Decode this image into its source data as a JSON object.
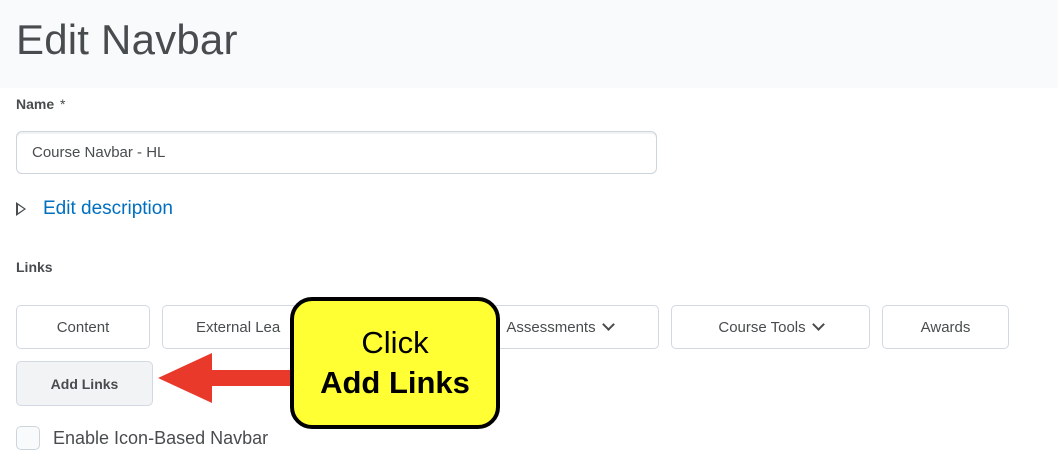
{
  "page": {
    "title": "Edit Navbar"
  },
  "name_field": {
    "label": "Name",
    "required_mark": "*",
    "value": "Course Navbar - HL"
  },
  "description": {
    "toggle_icon": "triangle-right-icon",
    "link_text": "Edit description"
  },
  "links": {
    "label": "Links",
    "items": [
      {
        "label": "Content",
        "has_dropdown": false
      },
      {
        "label": "External Lea",
        "has_dropdown": false
      },
      {
        "label": "Assessments",
        "has_dropdown": true
      },
      {
        "label": "Course Tools",
        "has_dropdown": true
      },
      {
        "label": "Awards",
        "has_dropdown": false
      }
    ],
    "add_button": "Add Links"
  },
  "icon_navbar": {
    "label": "Enable Icon-Based Navbar",
    "checked": false
  },
  "annotation": {
    "line1": "Click",
    "line2": "Add Links",
    "box_color": "#ffff33",
    "arrow_color": "#e8392b"
  },
  "colors": {
    "link": "#006fbf",
    "text": "#494c4e",
    "border": "#d3d9e3"
  }
}
